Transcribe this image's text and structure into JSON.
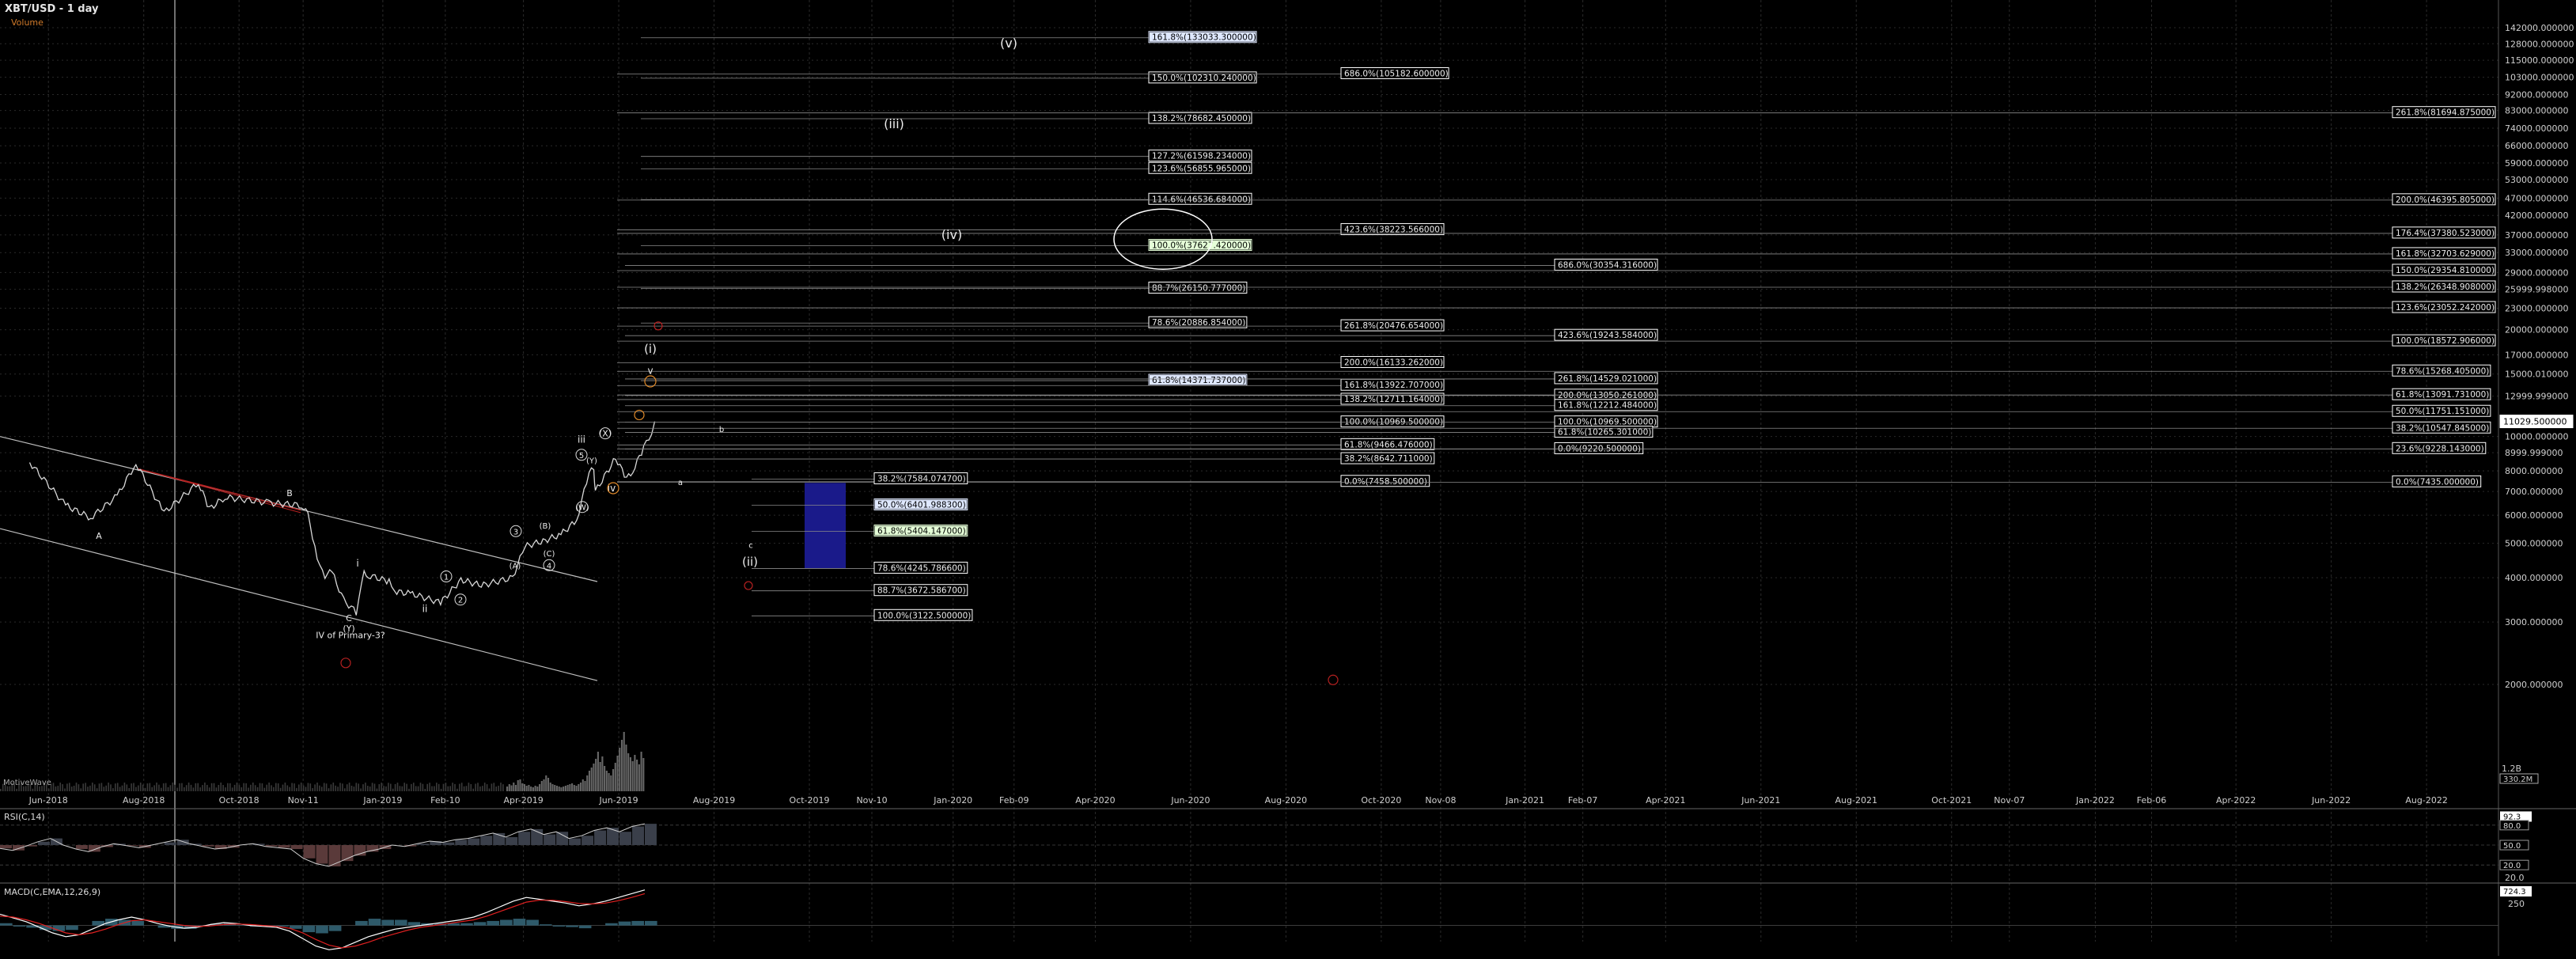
{
  "header": {
    "title": "XBT/USD - 1 day",
    "volume_label": "Volume"
  },
  "colors": {
    "background": "#000000",
    "grid": "#2a2a2a",
    "price": "#d8d8d8",
    "channel": "#bfbfbf",
    "red_line": "#b52020",
    "fib_box": "#ffffff",
    "fib_box_highlight_blue": "#dfe8ff",
    "fib_box_highlight_green": "#e5ffd8",
    "retrace_box": "#1a1a8a",
    "volume": "#666666",
    "rsi": "#cfcfcf",
    "macd_line": "#ffffff",
    "macd_signal": "#e02020"
  },
  "chart_data": {
    "type": "line",
    "series_name": "XBT/USD - 1 day",
    "x_tick_labels": [
      "Jun-2018",
      "Aug-2018",
      "Oct-2018",
      "Nov-11",
      "Jan-2019",
      "Feb-10",
      "Apr-2019",
      "Jun-2019",
      "Aug-2019",
      "Oct-2019",
      "Nov-10",
      "Jan-2020",
      "Feb-09",
      "Apr-2020",
      "Jun-2020",
      "Aug-2020",
      "Oct-2020",
      "Nov-08",
      "Jan-2021",
      "Feb-07",
      "Apr-2021",
      "Jun-2021",
      "Aug-2021",
      "Oct-2021",
      "Nov-07",
      "Jan-2022",
      "Feb-06",
      "Apr-2022",
      "Jun-2022",
      "Aug-2022"
    ],
    "y_scale": "log",
    "y_tick_labels": [
      "142000.000000",
      "128000.000000",
      "115000.000000",
      "103000.000000",
      "92000.000000",
      "83000.000000",
      "74000.000000",
      "66000.000000",
      "59000.000000",
      "53000.000000",
      "47000.000000",
      "42000.000000",
      "37000.000000",
      "33000.000000",
      "29000.000000",
      "25999.998000",
      "23000.000000",
      "20000.000000",
      "17000.000000",
      "15000.010000",
      "12999.999000",
      "10000.000000",
      "8999.999000",
      "8000.000000",
      "7000.000000",
      "6000.000000",
      "5000.000000",
      "4000.000000",
      "3000.000000",
      "2000.000000"
    ],
    "last_price_label": "11029.500000",
    "price_points": [
      [
        "2018-05-20",
        8450
      ],
      [
        "2018-06-12",
        6400
      ],
      [
        "2018-06-28",
        5900
      ],
      [
        "2018-07-15",
        6800
      ],
      [
        "2018-07-27",
        8400
      ],
      [
        "2018-08-14",
        6100
      ],
      [
        "2018-09-05",
        7400
      ],
      [
        "2018-09-12",
        6250
      ],
      [
        "2018-09-22",
        6750
      ],
      [
        "2018-10-20",
        6500
      ],
      [
        "2018-11-10",
        6400
      ],
      [
        "2018-11-14",
        6000
      ],
      [
        "2018-11-20",
        4600
      ],
      [
        "2018-11-25",
        3900
      ],
      [
        "2018-11-28",
        4300
      ],
      [
        "2018-12-07",
        3450
      ],
      [
        "2018-12-15",
        3200
      ],
      [
        "2018-12-20",
        4100
      ],
      [
        "2018-12-24",
        4050
      ],
      [
        "2019-01-05",
        3900
      ],
      [
        "2019-01-10",
        3650
      ],
      [
        "2019-01-20",
        3600
      ],
      [
        "2019-02-07",
        3400
      ],
      [
        "2019-02-20",
        3950
      ],
      [
        "2019-03-05",
        3800
      ],
      [
        "2019-03-25",
        4000
      ],
      [
        "2019-04-02",
        4900
      ],
      [
        "2019-04-15",
        5100
      ],
      [
        "2019-04-25",
        5300
      ],
      [
        "2019-05-05",
        5800
      ],
      [
        "2019-05-13",
        7900
      ],
      [
        "2019-05-16",
        8100
      ],
      [
        "2019-05-17",
        7000
      ],
      [
        "2019-05-30",
        8700
      ],
      [
        "2019-06-06",
        7600
      ],
      [
        "2019-06-10",
        8000
      ],
      [
        "2019-06-17",
        9300
      ],
      [
        "2019-06-22",
        10300
      ],
      [
        "2019-06-24",
        11029
      ]
    ],
    "volume_values": [
      12,
      18,
      15,
      22,
      16,
      28,
      30,
      20,
      18,
      14,
      16,
      12,
      10,
      14,
      12,
      18,
      26,
      30,
      40,
      34,
      22,
      18,
      16,
      14,
      12,
      10,
      12,
      14,
      16,
      18,
      20,
      16,
      14,
      18,
      22,
      30,
      26,
      40,
      52,
      60,
      70,
      82,
      100,
      74,
      88,
      64,
      52,
      46,
      40,
      56,
      72,
      90,
      110,
      130,
      150,
      118,
      96,
      86,
      76,
      92,
      80,
      68,
      100,
      84
    ],
    "rsi_values": [
      45,
      42,
      48,
      55,
      60,
      50,
      44,
      40,
      47,
      52,
      49,
      46,
      50,
      54,
      58,
      52,
      48,
      44,
      46,
      50,
      52,
      48,
      46,
      44,
      30,
      22,
      18,
      26,
      34,
      40,
      44,
      50,
      48,
      52,
      56,
      54,
      58,
      60,
      64,
      68,
      62,
      70,
      74,
      66,
      70,
      60,
      64,
      72,
      76,
      70,
      78,
      82
    ],
    "macd_values": [
      120,
      80,
      40,
      -20,
      -80,
      -120,
      -100,
      -40,
      20,
      60,
      90,
      60,
      20,
      -10,
      -30,
      -20,
      10,
      30,
      20,
      0,
      -10,
      -20,
      -60,
      -140,
      -220,
      -260,
      -240,
      -180,
      -120,
      -80,
      -40,
      -20,
      0,
      20,
      40,
      60,
      90,
      140,
      200,
      260,
      300,
      280,
      260,
      240,
      210,
      230,
      260,
      300,
      340,
      380
    ],
    "macd_signal_values": [
      100,
      90,
      60,
      20,
      -30,
      -80,
      -100,
      -80,
      -40,
      10,
      50,
      60,
      40,
      20,
      0,
      -10,
      -5,
      10,
      15,
      10,
      0,
      -10,
      -30,
      -80,
      -150,
      -210,
      -240,
      -220,
      -180,
      -130,
      -90,
      -50,
      -20,
      0,
      20,
      40,
      60,
      100,
      150,
      200,
      250,
      270,
      270,
      255,
      235,
      230,
      240,
      265,
      300,
      340
    ],
    "rsi_label": "RSI(C,14)",
    "rsi_tick_labels": [
      "92.3",
      "20.0"
    ],
    "rsi_right_boxes": [
      "80.0",
      "50.0",
      "20.0"
    ],
    "macd_label": "MACD(C,EMA,12,26,9)",
    "macd_tick_labels": [
      "250"
    ],
    "macd_right_box": "724.3",
    "volume_axis_labels": [
      "1.2B",
      "330.2M"
    ],
    "volume_indicator_label": "MotiveWave",
    "fib_labels_top": [
      "161.8%(133033.300000)",
      "150.0%(102310.240000)",
      "138.2%(78682.450000)",
      "127.2%(61598.234000)",
      "123.6%(56855.965000)",
      "114.6%(46536.684000)",
      "100.0%(37627.420000)",
      "88.7%(26150.777000)",
      "78.6%(20886.854000)",
      "61.8%(14371.737000)"
    ],
    "fib_labels_mid": [
      "686.0%(105182.600000)",
      "423.6%(38223.566000)",
      "261.8%(20476.654000)",
      "200.0%(16133.262000)",
      "161.8%(13922.707000)",
      "138.2%(12711.164000)",
      "100.0%(10969.500000)",
      "61.8%(9466.476000)",
      "38.2%(8642.711000)",
      "0.0%(7458.500000)"
    ],
    "fib_labels_right_mid": [
      "686.0%(30354.316000)",
      "423.6%(19243.584000)",
      "261.8%(14529.021000)",
      "200.0%(13050.261000)",
      "161.8%(12212.484000)",
      "100.0%(10969.500000)",
      "61.8%(10265.301000)",
      "0.0%(9220.500000)"
    ],
    "fib_labels_far_right": [
      "261.8%(81694.875000)",
      "200.0%(46395.805000)",
      "176.4%(37380.523000)",
      "161.8%(32703.629000)",
      "150.0%(29354.810000)",
      "138.2%(26348.908000)",
      "123.6%(23052.242000)",
      "100.0%(18572.906000)",
      "78.6%(15268.405000)",
      "61.8%(13091.731000)",
      "50.0%(11751.151000)",
      "38.2%(10547.845000)",
      "23.6%(9228.143000)",
      "0.0%(7435.000000)"
    ],
    "fib_labels_retrace": [
      "38.2%(7584.074700)",
      "50.0%(6401.988300)",
      "61.8%(5404.147000)",
      "78.6%(4245.786600)",
      "88.7%(3672.586700)",
      "100.0%(3122.500000)"
    ],
    "wave_labels": [
      "(v)",
      "(iii)",
      "(iv)",
      "(i)",
      "(ii)",
      "IV of Primary-3?",
      "A",
      "B",
      "C",
      "(Y)",
      "i",
      "ii",
      "iii",
      "iv",
      "v",
      "a",
      "b",
      "c",
      "1",
      "2",
      "3",
      "4",
      "5",
      "(A)",
      "(B)",
      "(C)",
      "(W)",
      "(X)",
      "(Y)"
    ]
  }
}
